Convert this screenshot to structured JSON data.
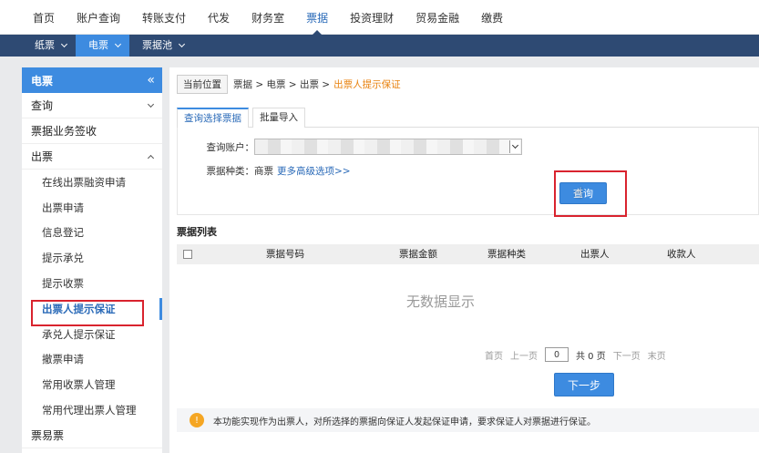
{
  "topnav": {
    "items": [
      "首页",
      "账户查询",
      "转账支付",
      "代发",
      "财务室",
      "票据",
      "投资理财",
      "贸易金融",
      "缴费"
    ],
    "active_index": 5
  },
  "subnav": {
    "items": [
      "纸票",
      "电票",
      "票据池"
    ],
    "active_index": 1
  },
  "sidebar": {
    "title": "电票",
    "collapse_glyph": "«",
    "query_group": "查询",
    "sign_item": "票据业务签收",
    "issue_group": "出票",
    "issue_items": [
      "在线出票融资申请",
      "出票申请",
      "信息登记",
      "提示承兑",
      "提示收票",
      "出票人提示保证",
      "承兑人提示保证",
      "撤票申请",
      "常用收票人管理",
      "常用代理出票人管理"
    ],
    "active_item": "出票人提示保证",
    "bottom_item": "票易票"
  },
  "breadcrumb": {
    "label": "当前位置",
    "path": "票据 > 电票 > 出票 >",
    "current": "出票人提示保证"
  },
  "tabs": [
    "查询选择票据",
    "批量导入"
  ],
  "form": {
    "account_label": "查询账户：",
    "type_label": "票据种类：",
    "type_value": "商票",
    "advanced_link": "更多高级选项>>",
    "query_button": "查询"
  },
  "table": {
    "title": "票据列表",
    "columns": [
      "票据号码",
      "票据金额",
      "票据种类",
      "出票人",
      "收款人"
    ],
    "empty_text": "无数据显示"
  },
  "pager": {
    "first": "首页",
    "prev": "上一页",
    "page_value": "0",
    "total": "共 0 页",
    "next": "下一页",
    "last": "末页"
  },
  "next_button": "下一步",
  "tip": {
    "icon_glyph": "!",
    "text": "本功能实现作为出票人，对所选择的票据向保证人发起保证申请，要求保证人对票据进行保证。"
  },
  "colors": {
    "accent": "#3d8be0",
    "subnav_bg": "#2e4a73",
    "highlight": "#d9232e",
    "breadcrumb_current": "#e8810d"
  }
}
